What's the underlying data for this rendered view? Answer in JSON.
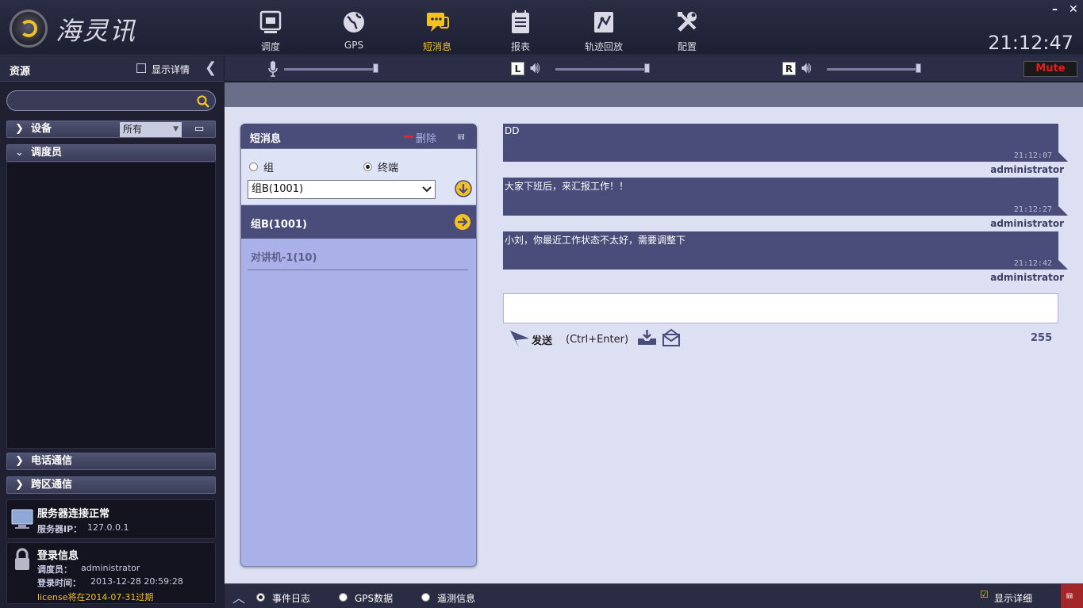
{
  "app": {
    "name": "海灵讯"
  },
  "clock": "21:12:47",
  "window": {
    "minimize": "–",
    "close": "✕"
  },
  "nav": [
    {
      "label": "调度",
      "icon": "dispatch-icon"
    },
    {
      "label": "GPS",
      "icon": "globe-icon"
    },
    {
      "label": "短消息",
      "icon": "message-icon"
    },
    {
      "label": "报表",
      "icon": "report-icon"
    },
    {
      "label": "轨迹回放",
      "icon": "track-playback-icon"
    },
    {
      "label": "配置",
      "icon": "settings-tools-icon"
    }
  ],
  "left": {
    "title": "资源",
    "show_details": "显示详情",
    "search_placeholder": "",
    "device_label": "设备",
    "device_filter": "所有",
    "dispatcher_label": "调度员",
    "phone_label": "电话通信",
    "cross_label": "跨区通信",
    "server": {
      "status": "服务器连接正常",
      "ip_label": "服务器IP：",
      "ip": "127.0.0.1"
    },
    "login": {
      "title": "登录信息",
      "user_label": "调度员：",
      "user": "administrator",
      "time_label": "登录时间：",
      "time": "2013-12-28 20:59:28",
      "license": "license将在2014-07-31过期"
    }
  },
  "audio": {
    "mute": "Mute",
    "left": "L",
    "right": "R",
    "mic_level": 1.0,
    "left_level": 1.0,
    "right_level": 1.0
  },
  "msgpanel": {
    "title": "短消息",
    "delete": "删除",
    "radio_group": "组",
    "radio_terminal": "终端",
    "selected": "组B(1001)",
    "items": [
      "组B(1001)",
      "对讲机-1(10)"
    ]
  },
  "messages": [
    {
      "text": "DD",
      "time": "21:12:07",
      "sender": "administrator"
    },
    {
      "text": "大家下班后，来汇报工作！！",
      "time": "21:12:27",
      "sender": "administrator"
    },
    {
      "text": "小刘，你最近工作状态不太好，需要调整下",
      "time": "21:12:42",
      "sender": "administrator"
    }
  ],
  "compose": {
    "send": "发送",
    "shortcut": "(Ctrl+Enter)",
    "remaining": "255",
    "value": ""
  },
  "statusbar": {
    "event_log": "事件日志",
    "gps_data": "GPS数据",
    "telemetry": "遥测信息",
    "show_details": "显示详细"
  }
}
